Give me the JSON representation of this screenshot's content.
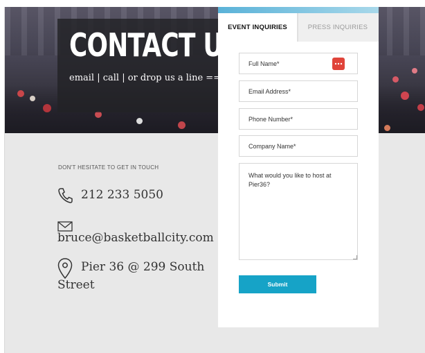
{
  "hero": {
    "title": "CONTACT US",
    "subtitle": "email | call | or drop us a line ==>"
  },
  "contact": {
    "section_label": "DON'T HESITATE TO GET IN TOUCH",
    "phone": "212 233 5050",
    "email": "bruce@basketballcity.com",
    "address_line1": "Pier 36 @ 299 South",
    "address_line2": "Street"
  },
  "form": {
    "tabs": [
      {
        "label": "EVENT INQUIRIES",
        "active": true
      },
      {
        "label": "PRESS INQUIRIES",
        "active": false
      }
    ],
    "fields": {
      "full_name": "Full Name*",
      "email": "Email Address*",
      "phone": "Phone Number*",
      "company": "Company Name*",
      "message": "What would you like to host at Pier36?"
    },
    "submit_label": "Submit"
  },
  "colors": {
    "accent": "#16a3c7",
    "password_manager_icon": "#e0443a",
    "background_gray": "#e8e8e8"
  },
  "icons": [
    "phone-icon",
    "envelope-icon",
    "location-pin-icon",
    "password-manager-icon"
  ]
}
